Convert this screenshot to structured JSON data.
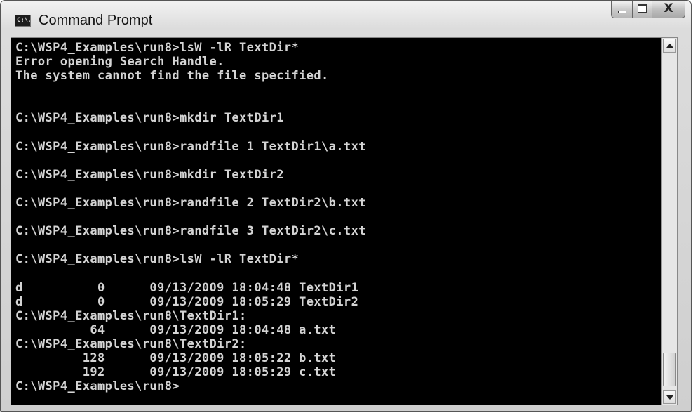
{
  "window": {
    "title": "Command Prompt",
    "icon": "cmd-icon",
    "icon_text": "C:\\."
  },
  "controls": {
    "minimize": "minimize-icon",
    "maximize": "maximize-icon",
    "close_glyph": "X"
  },
  "console": {
    "colors": {
      "background": "#000000",
      "text": "#d4d4d4"
    },
    "lines": [
      "C:\\WSP4_Examples\\run8>lsW -lR TextDir*",
      "Error opening Search Handle.",
      "The system cannot find the file specified.",
      "",
      "",
      "C:\\WSP4_Examples\\run8>mkdir TextDir1",
      "",
      "C:\\WSP4_Examples\\run8>randfile 1 TextDir1\\a.txt",
      "",
      "C:\\WSP4_Examples\\run8>mkdir TextDir2",
      "",
      "C:\\WSP4_Examples\\run8>randfile 2 TextDir2\\b.txt",
      "",
      "C:\\WSP4_Examples\\run8>randfile 3 TextDir2\\c.txt",
      "",
      "C:\\WSP4_Examples\\run8>lsW -lR TextDir*",
      "",
      "d          0      09/13/2009 18:04:48 TextDir1",
      "d          0      09/13/2009 18:05:29 TextDir2",
      "C:\\WSP4_Examples\\run8\\TextDir1:",
      "          64      09/13/2009 18:04:48 a.txt",
      "C:\\WSP4_Examples\\run8\\TextDir2:",
      "         128      09/13/2009 18:05:22 b.txt",
      "         192      09/13/2009 18:05:29 c.txt",
      "C:\\WSP4_Examples\\run8>"
    ]
  },
  "scrollbar": {
    "up": "scroll-up-arrow-icon",
    "down": "scroll-down-arrow-icon"
  }
}
